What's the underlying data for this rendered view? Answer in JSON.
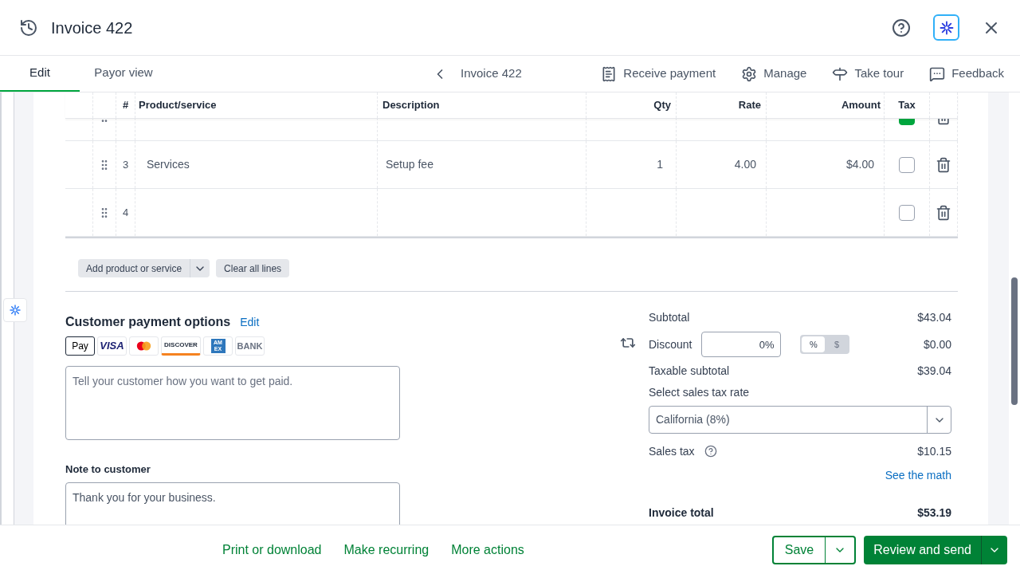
{
  "header": {
    "title": "Invoice 422"
  },
  "tabs": [
    {
      "label": "Edit",
      "selected": true
    },
    {
      "label": "Payor view",
      "selected": false
    }
  ],
  "nav": {
    "label": "Invoice 422"
  },
  "toolbar": [
    {
      "kind": "payment",
      "label": "Receive payment"
    },
    {
      "kind": "gear",
      "label": "Manage"
    },
    {
      "kind": "signpost",
      "label": "Take tour"
    },
    {
      "kind": "chat",
      "label": "Feedback"
    }
  ],
  "table": {
    "columns": [
      "#",
      "Product/service",
      "Description",
      "Qty",
      "Rate",
      "Amount",
      "Tax"
    ],
    "rows": [
      {
        "taxed": true
      },
      {
        "number": "3",
        "product": "Services",
        "description": "Setup fee",
        "qty": "1",
        "rate": "4.00",
        "amount": "$4.00",
        "taxed": false
      },
      {
        "number": "4",
        "taxed": false
      }
    ]
  },
  "line_buttons": {
    "add": "Add product or service",
    "clear": "Clear all lines"
  },
  "payment_options": {
    "title": "Customer payment options",
    "edit": "Edit",
    "methods": [
      {
        "kind": "applepay",
        "label": "Pay"
      },
      {
        "kind": "visa",
        "label": "VISA"
      },
      {
        "kind": "mastercard"
      },
      {
        "kind": "discover",
        "label": "DISCOVER"
      },
      {
        "kind": "amex",
        "label": "AM EX"
      },
      {
        "kind": "bank",
        "label": "BANK"
      }
    ],
    "placeholder": "Tell your customer how you want to get paid."
  },
  "note": {
    "label": "Note to customer",
    "value": "Thank you for your business."
  },
  "totals": {
    "subtotal_label": "Subtotal",
    "subtotal": "$43.04",
    "discount_label": "Discount",
    "discount_value": "0%",
    "discount_modes": [
      {
        "label": "%",
        "selected": true
      },
      {
        "label": "$",
        "selected": false
      }
    ],
    "discount": "$0.00",
    "taxable_label": "Taxable subtotal",
    "taxable": "$39.04",
    "rate_label": "Select sales tax rate",
    "rate": "California (8%)",
    "tax_label": "Sales tax",
    "tax": "$10.15",
    "math_link": "See the math",
    "total_label": "Invoice total",
    "total": "$53.19"
  },
  "footer": {
    "links": [
      "Print or download",
      "Make recurring",
      "More actions"
    ],
    "save": "Save",
    "send": "Review and send"
  }
}
